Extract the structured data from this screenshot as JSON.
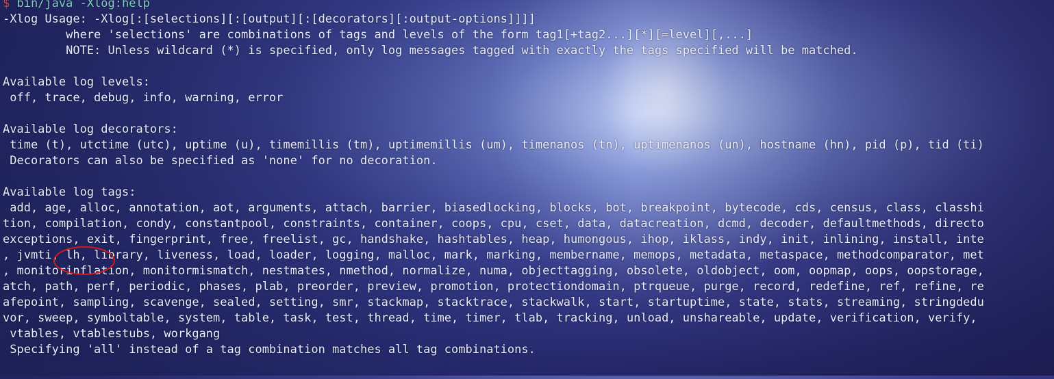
{
  "terminal": {
    "lines": [
      {
        "type": "prompt",
        "prompt": "$ ",
        "command": "bin/java -Xlog:help"
      },
      {
        "text": "-Xlog Usage: -Xlog[:[selections][:[output][:[decorators][:output-options]]]]"
      },
      {
        "text": "         where 'selections' are combinations of tags and levels of the form tag1[+tag2...][*][=level][,...]"
      },
      {
        "text": "         NOTE: Unless wildcard (*) is specified, only log messages tagged with exactly the tags specified will be matched."
      },
      {
        "text": ""
      },
      {
        "text": "Available log levels:"
      },
      {
        "text": " off, trace, debug, info, warning, error"
      },
      {
        "text": ""
      },
      {
        "text": "Available log decorators:"
      },
      {
        "text": " time (t), utctime (utc), uptime (u), timemillis (tm), uptimemillis (um), timenanos (tn), uptimenanos (un), hostname (hn), pid (p), tid (ti)"
      },
      {
        "text": " Decorators can also be specified as 'none' for no decoration."
      },
      {
        "text": ""
      },
      {
        "text": "Available log tags:"
      },
      {
        "text": " add, age, alloc, annotation, aot, arguments, attach, barrier, biasedlocking, blocks, bot, breakpoint, bytecode, cds, census, class, classhi"
      },
      {
        "text": "tion, compilation, condy, constantpool, constraints, container, coops, cpu, cset, data, datacreation, dcmd, decoder, defaultmethods, directo"
      },
      {
        "text": "exceptions, exit, fingerprint, free, freelist, gc, handshake, hashtables, heap, humongous, ihop, iklass, indy, init, inlining, install, inte"
      },
      {
        "text": ", jvmti, lh, library, liveness, load, loader, logging, malloc, mark, marking, membername, memops, metadata, metaspace, methodcomparator, met"
      },
      {
        "text": ", monitorinflation, monitormismatch, nestmates, nmethod, normalize, numa, objecttagging, obsolete, oldobject, oom, oopmap, oops, oopstorage,"
      },
      {
        "text": "atch, path, perf, periodic, phases, plab, preorder, preview, promotion, protectiondomain, ptrqueue, purge, record, redefine, ref, refine, re"
      },
      {
        "text": "afepoint, sampling, scavenge, sealed, setting, smr, stackmap, stacktrace, stackwalk, start, startuptime, state, stats, streaming, stringdedu"
      },
      {
        "text": "vor, sweep, symboltable, system, table, task, test, thread, time, timer, tlab, tracking, unload, unshareable, update, verification, verify,"
      },
      {
        "text": " vtables, vtablestubs, workgang"
      },
      {
        "text": " Specifying 'all' instead of a tag combination matches all tag combinations."
      }
    ]
  },
  "annotation": {
    "color": "#d21c1c",
    "circled_tag": "lh"
  },
  "colors": {
    "text": "#e8ecff",
    "prompt": "#e04040",
    "command": "#7fd0c0"
  }
}
